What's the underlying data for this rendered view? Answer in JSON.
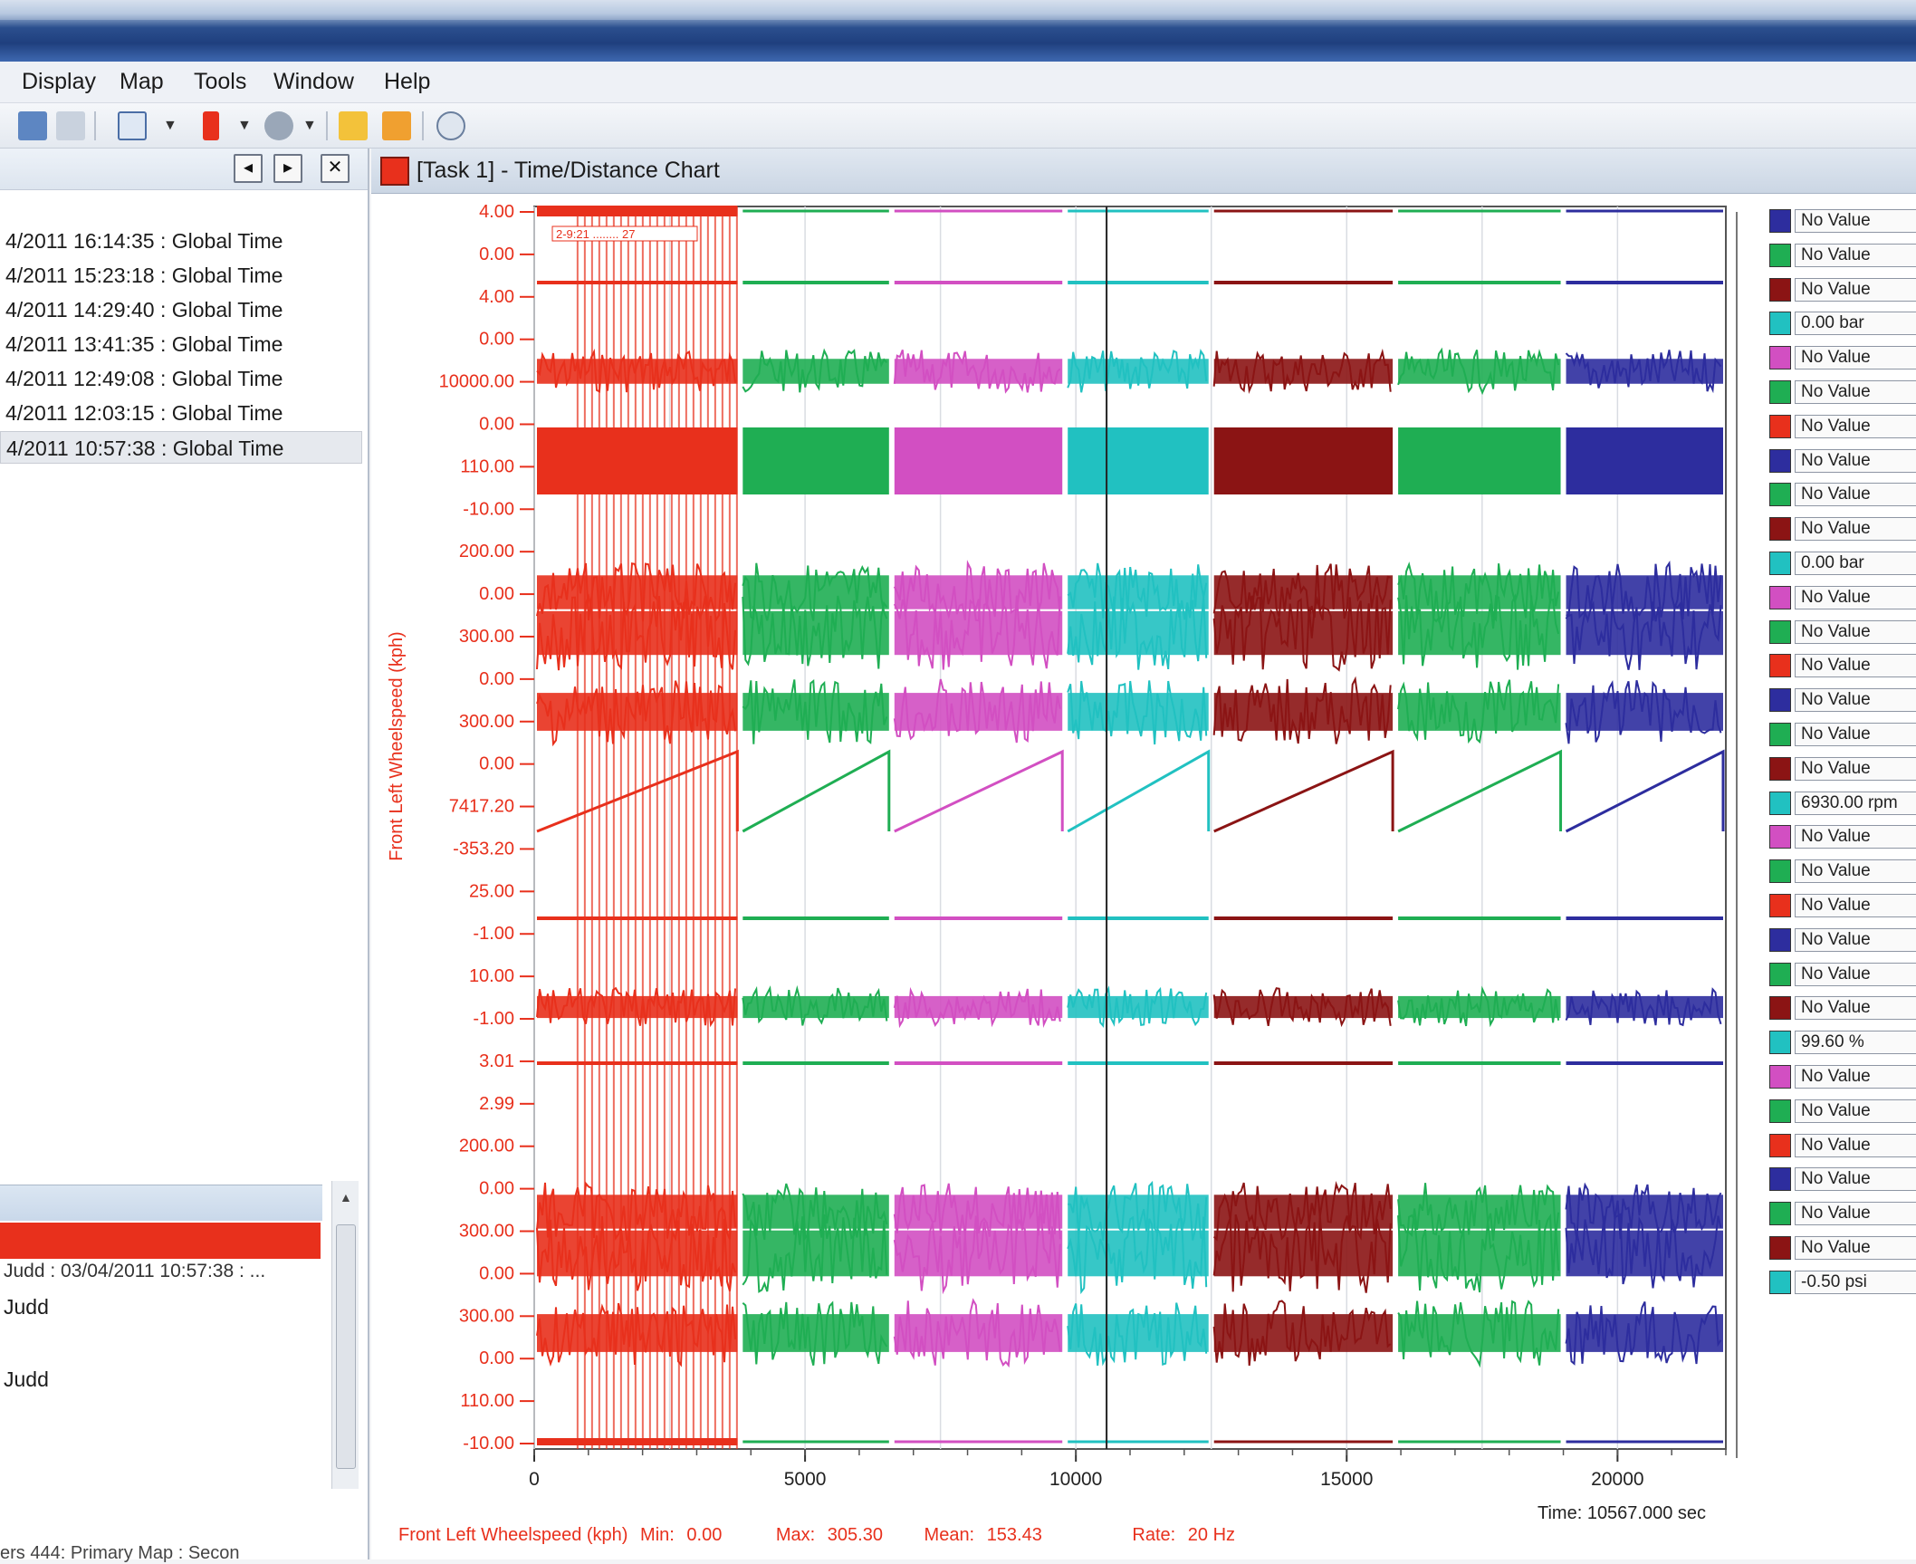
{
  "menu": [
    "Display",
    "Map",
    "Tools",
    "Window",
    "Help"
  ],
  "sessions": [
    "4/2011 16:14:35 : Global Time",
    "4/2011 15:23:18 : Global Time",
    "4/2011 14:29:40 : Global Time",
    "4/2011 13:41:35 : Global Time",
    "4/2011 12:49:08 : Global Time",
    "4/2011 12:03:15 : Global Time",
    "4/2011 10:57:38 : Global Time"
  ],
  "selected_session_index": 6,
  "lower_panel": {
    "lines": [
      "Judd : 03/04/2011 10:57:38 : ...",
      "Judd",
      "Judd"
    ],
    "status": "ers 444: Primary Map : Secon"
  },
  "chart_window": {
    "title": "[Task 1] - Time/Distance Chart"
  },
  "chart_data": {
    "type": "line",
    "x_ticks": [
      "0",
      "5000",
      "10000",
      "15000",
      "20000"
    ],
    "xlim": [
      0,
      22000
    ],
    "cursor_x": 10567,
    "y_axis_label": "Front Left Wheelspeed (kph)",
    "y_tick_labels": [
      "4.00",
      "0.00",
      "4.00",
      "0.00",
      "10000.00",
      "0.00",
      "110.00",
      "-10.00",
      "200.00",
      "0.00",
      "300.00",
      "0.00",
      "300.00",
      "0.00",
      "7417.20",
      "-353.20",
      "25.00",
      "-1.00",
      "10.00",
      "-1.00",
      "3.01",
      "2.99",
      "200.00",
      "0.00",
      "300.00",
      "0.00",
      "300.00",
      "0.00",
      "110.00",
      "-10.00"
    ],
    "lap_boundaries": [
      0,
      3800,
      6600,
      9800,
      12500,
      15900,
      19000,
      22000
    ],
    "lap_colors": [
      "#e8301c",
      "#1fae53",
      "#d24fc2",
      "#21c1c1",
      "#8b1414",
      "#1fae53",
      "#2d2d9e"
    ],
    "annotation": "2-9:21 ........ 27",
    "time_readout": "Time: 10567.000 sec",
    "stats": {
      "channel": "Front Left Wheelspeed (kph)",
      "min_label": "Min:",
      "min": "0.00",
      "max_label": "Max:",
      "max": "305.30",
      "mean_label": "Mean:",
      "mean": "153.43",
      "rate_label": "Rate:",
      "rate": "20 Hz"
    }
  },
  "legend": [
    {
      "color": "#2d2d9e",
      "value": "No Value"
    },
    {
      "color": "#1fae53",
      "value": "No Value"
    },
    {
      "color": "#8b1414",
      "value": "No Value"
    },
    {
      "color": "#21c1c1",
      "value": "0.00 bar"
    },
    {
      "color": "#d24fc2",
      "value": "No Value"
    },
    {
      "color": "#1fae53",
      "value": "No Value"
    },
    {
      "color": "#e8301c",
      "value": "No Value"
    },
    {
      "color": "#2d2d9e",
      "value": "No Value"
    },
    {
      "color": "#1fae53",
      "value": "No Value"
    },
    {
      "color": "#8b1414",
      "value": "No Value"
    },
    {
      "color": "#21c1c1",
      "value": "0.00 bar"
    },
    {
      "color": "#d24fc2",
      "value": "No Value"
    },
    {
      "color": "#1fae53",
      "value": "No Value"
    },
    {
      "color": "#e8301c",
      "value": "No Value"
    },
    {
      "color": "#2d2d9e",
      "value": "No Value"
    },
    {
      "color": "#1fae53",
      "value": "No Value"
    },
    {
      "color": "#8b1414",
      "value": "No Value"
    },
    {
      "color": "#21c1c1",
      "value": "6930.00 rpm"
    },
    {
      "color": "#d24fc2",
      "value": "No Value"
    },
    {
      "color": "#1fae53",
      "value": "No Value"
    },
    {
      "color": "#e8301c",
      "value": "No Value"
    },
    {
      "color": "#2d2d9e",
      "value": "No Value"
    },
    {
      "color": "#1fae53",
      "value": "No Value"
    },
    {
      "color": "#8b1414",
      "value": "No Value"
    },
    {
      "color": "#21c1c1",
      "value": "99.60 %"
    },
    {
      "color": "#d24fc2",
      "value": "No Value"
    },
    {
      "color": "#1fae53",
      "value": "No Value"
    },
    {
      "color": "#e8301c",
      "value": "No Value"
    },
    {
      "color": "#2d2d9e",
      "value": "No Value"
    },
    {
      "color": "#1fae53",
      "value": "No Value"
    },
    {
      "color": "#8b1414",
      "value": "No Value"
    },
    {
      "color": "#21c1c1",
      "value": "-0.50 psi"
    }
  ]
}
